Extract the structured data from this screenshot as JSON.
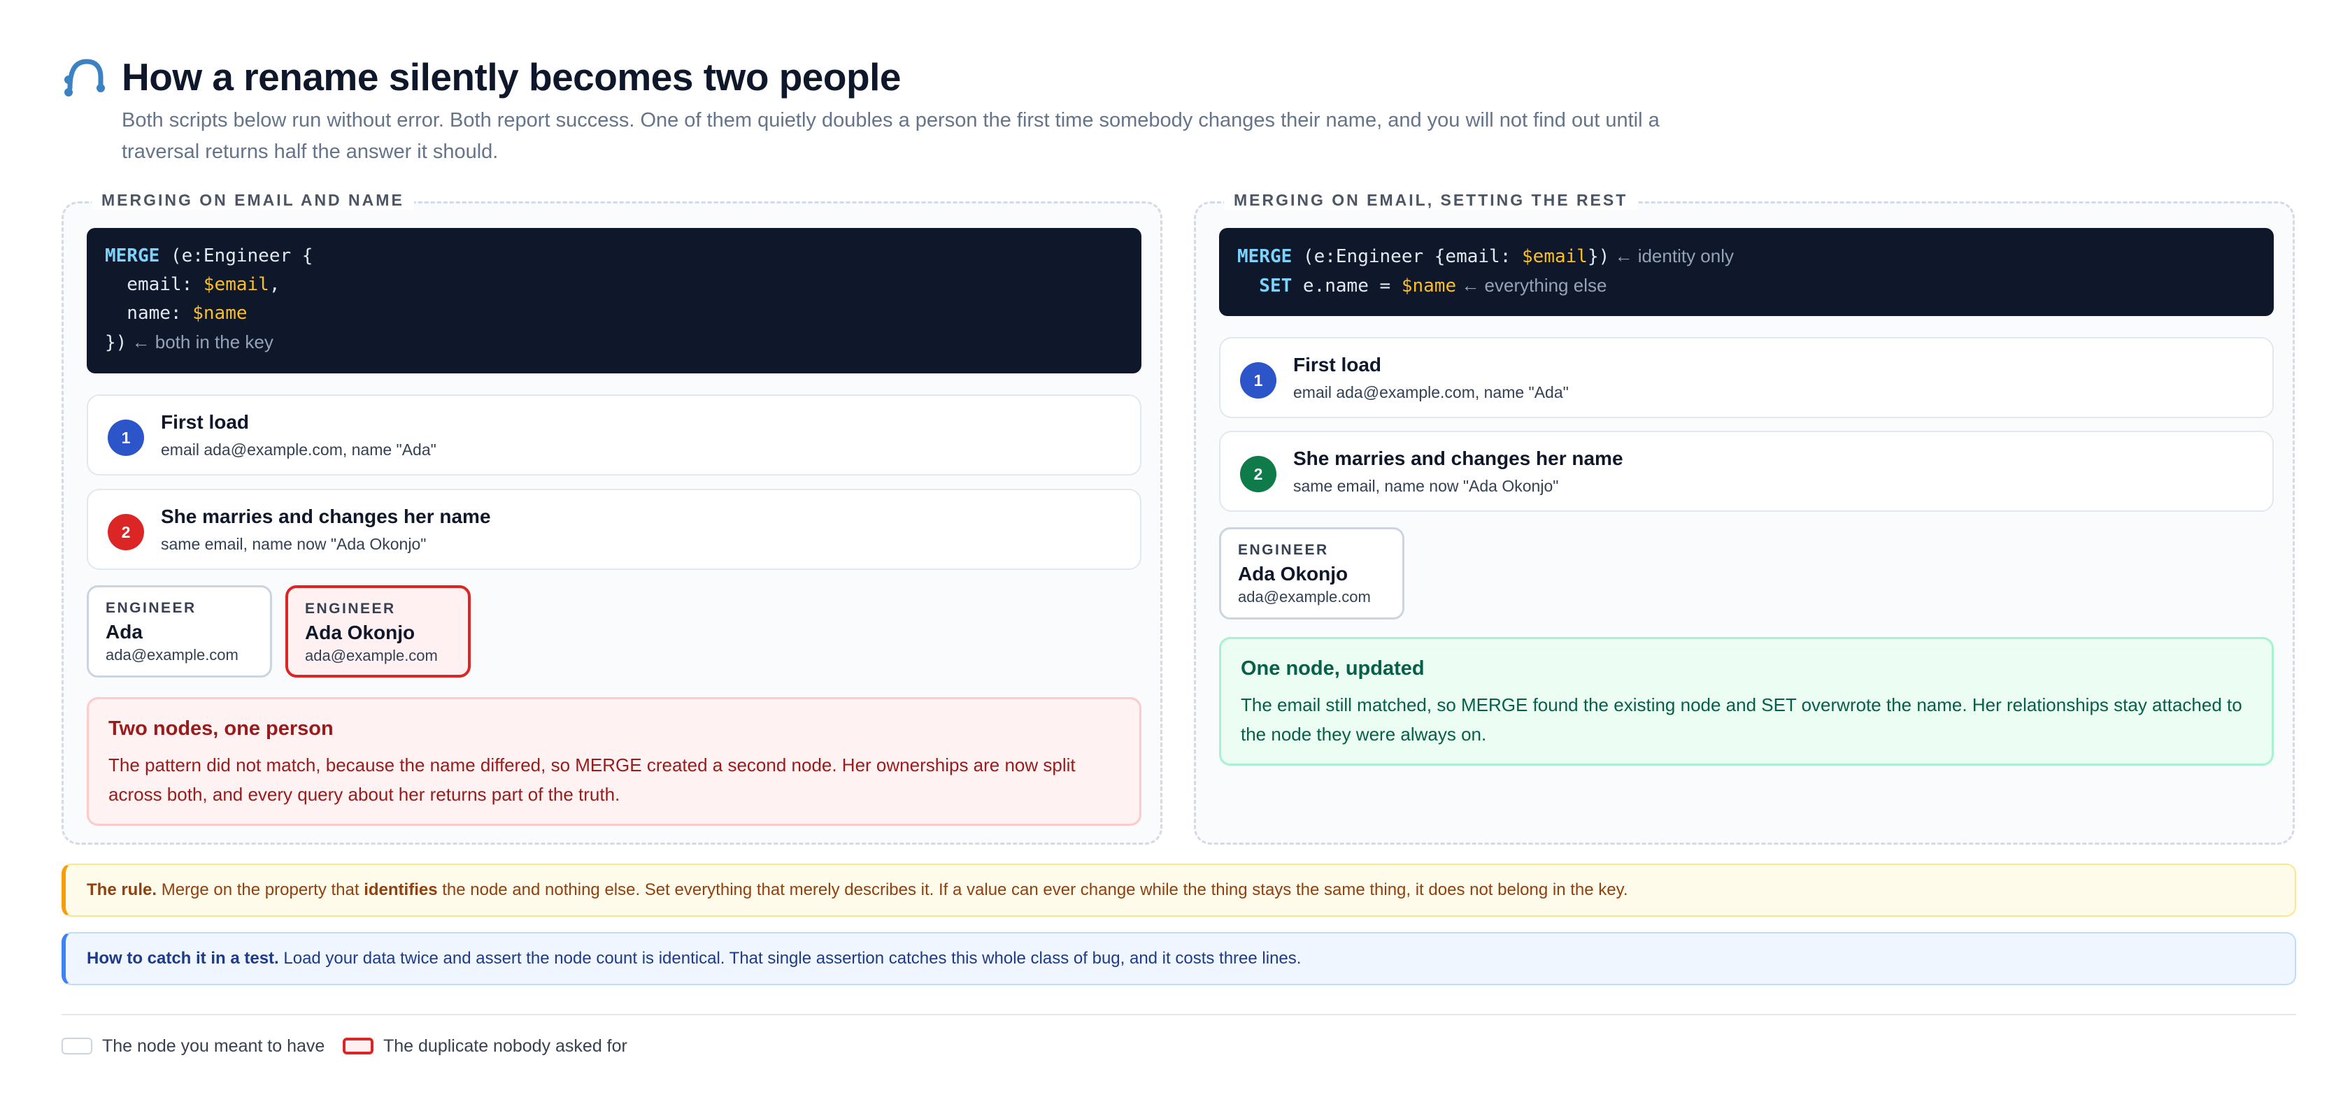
{
  "header": {
    "title": "How a rename silently becomes two people",
    "subtitle": "Both scripts below run without error. Both report success. One of them quietly doubles a person the first time somebody changes their name, and you will not find out until a traversal returns half the answer it should.",
    "logo_icon": "graph-path-icon"
  },
  "left": {
    "label": "MERGING ON EMAIL AND NAME",
    "code": {
      "l1_kw": "MERGE",
      "l1_rest": " (e:Engineer {",
      "l2_prop": "  email: ",
      "l2_var": "$email",
      "l2_end": ",",
      "l3_prop": "  name: ",
      "l3_var": "$name",
      "l4_rest": "})",
      "l4_comment": " ← both in the key"
    },
    "step1": {
      "num": "1",
      "title": "First load",
      "sub": "email ada@example.com, name \"Ada\""
    },
    "step2": {
      "num": "2",
      "title": "She marries and changes her name",
      "sub": "same email, name now \"Ada Okonjo\""
    },
    "node1": {
      "type": "ENGINEER",
      "name": "Ada",
      "email": "ada@example.com"
    },
    "node2": {
      "type": "ENGINEER",
      "name": "Ada Okonjo",
      "email": "ada@example.com"
    },
    "outcome": {
      "title": "Two nodes, one person",
      "text": "The pattern did not match, because the name differed, so MERGE created a second node. Her ownerships are now split across both, and every query about her returns part of the truth."
    }
  },
  "right": {
    "label": "MERGING ON EMAIL, SETTING THE REST",
    "code": {
      "l1_kw": "MERGE",
      "l1_rest": " (e:Engineer {email: ",
      "l1_var": "$email",
      "l1_end": "})",
      "l1_comment": " ← identity only",
      "l2_kw": "  SET",
      "l2_rest": " e.name = ",
      "l2_var": "$name",
      "l2_comment": " ← everything else"
    },
    "step1": {
      "num": "1",
      "title": "First load",
      "sub": "email ada@example.com, name \"Ada\""
    },
    "step2": {
      "num": "2",
      "title": "She marries and changes her name",
      "sub": "same email, name now \"Ada Okonjo\""
    },
    "node1": {
      "type": "ENGINEER",
      "name": "Ada Okonjo",
      "email": "ada@example.com"
    },
    "outcome": {
      "title": "One node, updated",
      "text": "The email still matched, so MERGE found the existing node and SET overwrote the name. Her relationships stay attached to the node they were always on."
    }
  },
  "notes": {
    "rule_lead": "The rule.",
    "rule_a": " Merge on the property that ",
    "rule_bold": "identifies",
    "rule_b": " the node and nothing else. Set everything that merely describes it. If a value can ever change while the thing stays the same thing, it does not belong in the key.",
    "test_lead": "How to catch it in a test.",
    "test_text": " Load your data twice and assert the node count is identical. That single assertion catches this whole class of bug, and it costs three lines."
  },
  "legend": {
    "normal": "The node you meant to have",
    "duplicate": "The duplicate nobody asked for"
  },
  "colors": {
    "accent_blue": "#2b55c9",
    "danger_red": "#dc2626",
    "success_green": "#0f7a4a",
    "code_bg": "#0f172a"
  }
}
